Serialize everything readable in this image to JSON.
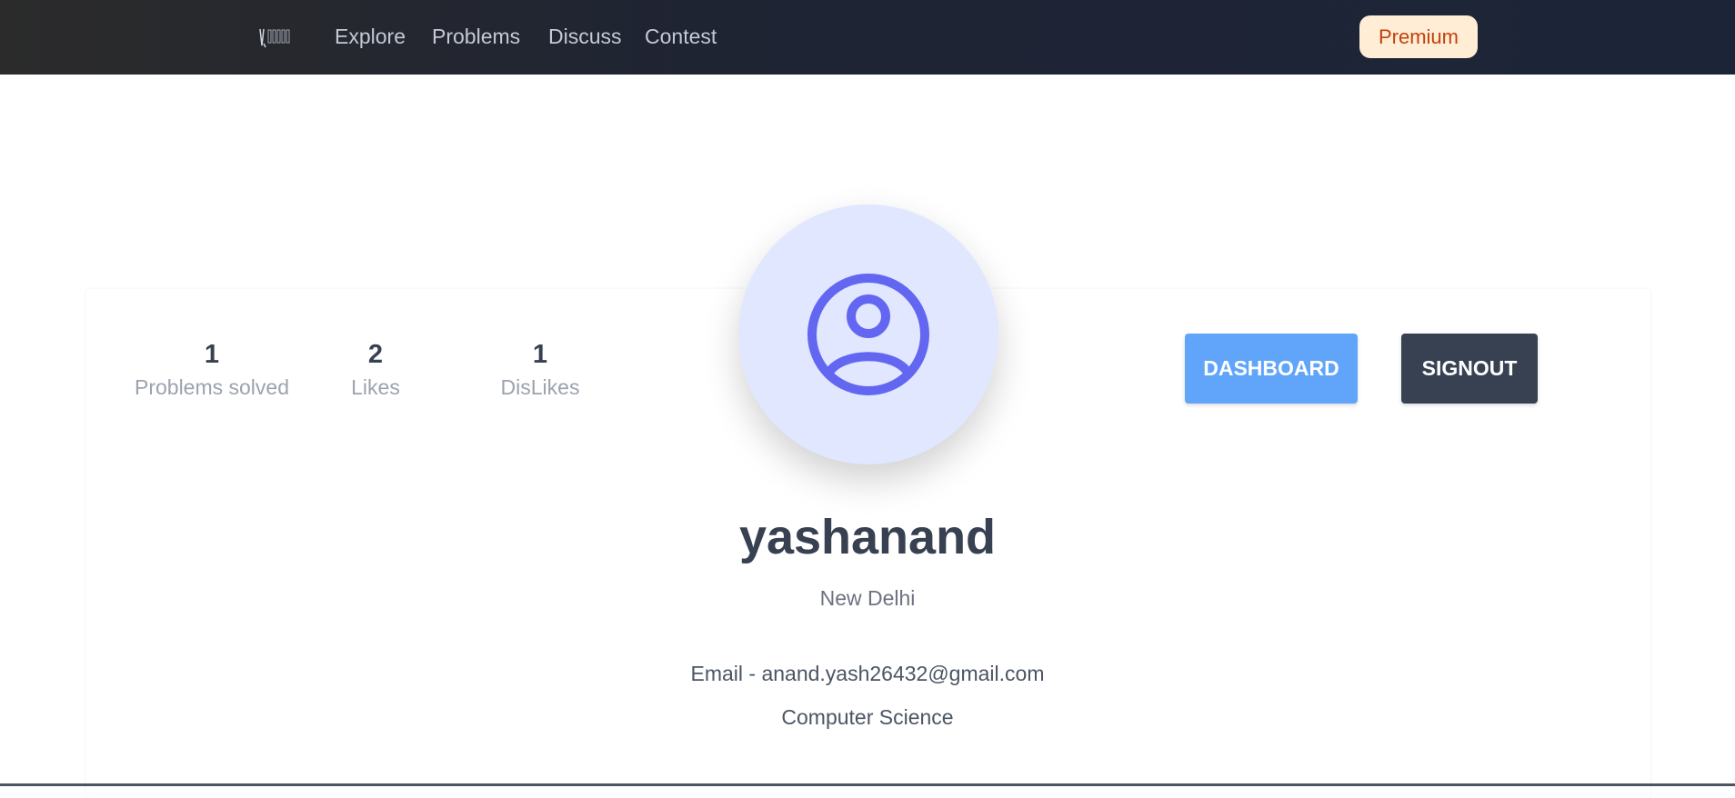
{
  "navbar": {
    "logo_icon": "codeburner-logo-icon",
    "links": [
      "Explore",
      "Problems",
      "Discuss",
      "Contest"
    ],
    "premium_label": "Premium"
  },
  "stats": [
    {
      "value": "1",
      "label": "Problems solved"
    },
    {
      "value": "2",
      "label": "Likes"
    },
    {
      "value": "1",
      "label": "DisLikes"
    }
  ],
  "avatar_icon": "user-circle-icon",
  "actions": {
    "dashboard_label": "DASHBOARD",
    "signout_label": "SIGNOUT"
  },
  "profile": {
    "username": "yashanand",
    "location": "New Delhi",
    "email": "Email - anand.yash26432@gmail.com",
    "branch": "Computer Science"
  },
  "colors": {
    "accent_indigo": "#6366f1",
    "avatar_bg": "#e0e7ff",
    "dashboard_blue": "#60a5fa",
    "signout_dark": "#374151",
    "premium_bg": "#ffedd5",
    "premium_text": "#c2410c"
  }
}
